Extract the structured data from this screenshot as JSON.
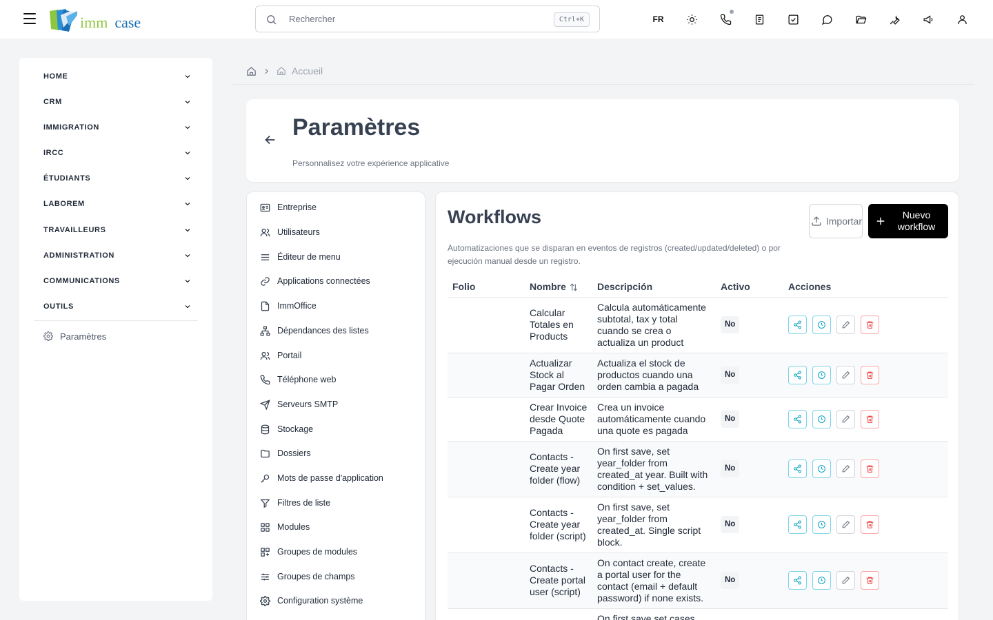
{
  "app": {
    "logo_text_1": "imm",
    "logo_text_2": "case",
    "search_placeholder": "Rechercher",
    "search_shortcut": "Ctrl+K",
    "language": "FR",
    "top_icons": [
      "sun-icon",
      "phone-icon",
      "notes-icon",
      "tasks-icon",
      "chat-icon",
      "folder-icon",
      "tools-icon",
      "megaphone-icon",
      "user-icon"
    ]
  },
  "sidebar": {
    "items": [
      {
        "label": "HOME"
      },
      {
        "label": "CRM"
      },
      {
        "label": "IMMIGRATION"
      },
      {
        "label": "IRCC"
      },
      {
        "label": "ÉTUDIANTS"
      },
      {
        "label": "LABOREM"
      },
      {
        "label": "TRAVAILLEURS"
      },
      {
        "label": "ADMINISTRATION"
      },
      {
        "label": "COMMUNICATIONS"
      },
      {
        "label": "OUTILS"
      }
    ],
    "settings_label": "Paramètres"
  },
  "breadcrumb": {
    "current": "Accueil"
  },
  "header": {
    "title": "Paramètres",
    "subtitle": "Personnalisez votre expérience applicative"
  },
  "settings_nav": {
    "items": [
      {
        "label": "Entreprise",
        "icon": "id-card-icon"
      },
      {
        "label": "Utilisateurs",
        "icon": "users-icon"
      },
      {
        "label": "Éditeur de menu",
        "icon": "menu-icon"
      },
      {
        "label": "Applications connectées",
        "icon": "link-icon"
      },
      {
        "label": "ImmOffice",
        "icon": "file-icon"
      },
      {
        "label": "Dépendances des listes",
        "icon": "hierarchy-icon"
      },
      {
        "label": "Portail",
        "icon": "users-icon"
      },
      {
        "label": "Téléphone web",
        "icon": "phone-icon"
      },
      {
        "label": "Serveurs SMTP",
        "icon": "send-icon"
      },
      {
        "label": "Stockage",
        "icon": "database-icon"
      },
      {
        "label": "Dossiers",
        "icon": "folder-icon"
      },
      {
        "label": "Mots de passe d'application",
        "icon": "key-icon"
      },
      {
        "label": "Filtres de liste",
        "icon": "filter-icon"
      },
      {
        "label": "Modules",
        "icon": "grid-icon"
      },
      {
        "label": "Groupes de modules",
        "icon": "grid-group-icon"
      },
      {
        "label": "Groupes de champs",
        "icon": "sliders-icon"
      },
      {
        "label": "Configuration système",
        "icon": "gear-icon"
      }
    ]
  },
  "workflows": {
    "title": "Workflows",
    "description": "Automatizaciones que se disparan en eventos de registros (created/updated/deleted) o por ejecución manual desde un registro.",
    "import_label": "Importar",
    "new_label": "Nuevo workflow",
    "columns": {
      "folio": "Folio",
      "nombre": "Nombre",
      "descripcion": "Descripción",
      "activo": "Activo",
      "acciones": "Acciones"
    },
    "rows": [
      {
        "folio": "",
        "nombre": "Calcular Totales en Products",
        "descripcion": "Calcula automáticamente subtotal, tax y total cuando se crea o actualiza un product",
        "activo": "No"
      },
      {
        "folio": "",
        "nombre": "Actualizar Stock al Pagar Orden",
        "descripcion": "Actualiza el stock de productos cuando una orden cambia a pagada",
        "activo": "No"
      },
      {
        "folio": "",
        "nombre": "Crear Invoice desde Quote Pagada",
        "descripcion": "Crea un invoice automáticamente cuando una quote es pagada",
        "activo": "No"
      },
      {
        "folio": "",
        "nombre": "Contacts - Create year folder (flow)",
        "descripcion": "On first save, set year_folder from created_at year. Built with condition + set_values.",
        "activo": "No"
      },
      {
        "folio": "",
        "nombre": "Contacts - Create year folder (script)",
        "descripcion": "On first save, set year_folder from created_at. Single script block.",
        "activo": "No"
      },
      {
        "folio": "",
        "nombre": "Contacts - Create portal user (script)",
        "descripcion": "On contact create, create a portal user for the contact (email + default password) if none exists.",
        "activo": "No"
      },
      {
        "folio": "",
        "nombre": "",
        "descripcion": "On first save set cases name from contact + case",
        "activo": ""
      }
    ]
  }
}
